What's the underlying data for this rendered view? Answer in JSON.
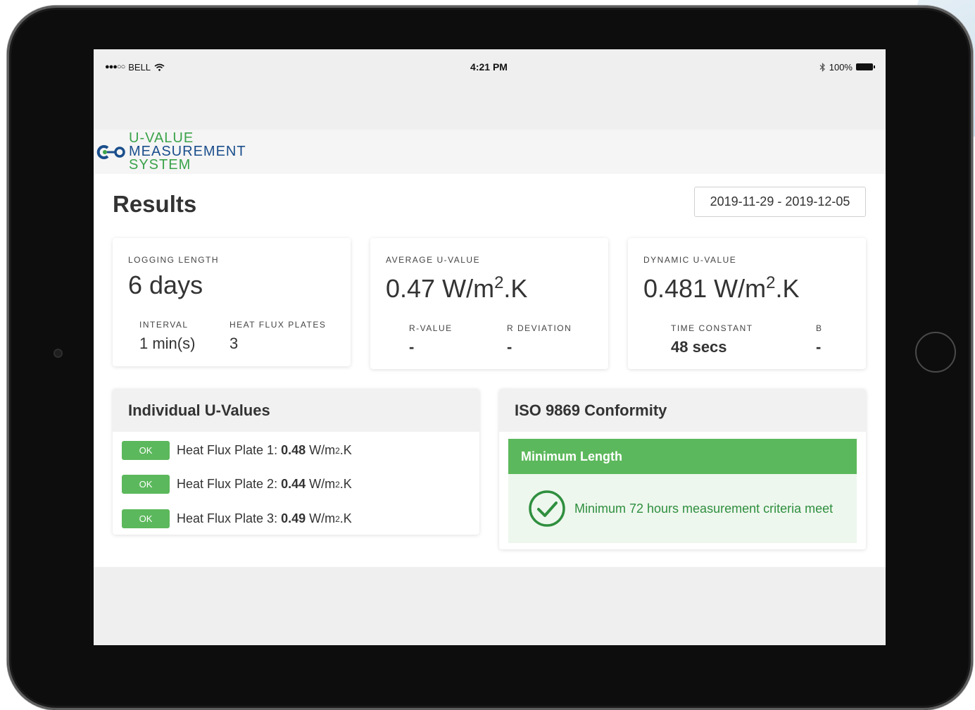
{
  "status_bar": {
    "signal": "●●●○○",
    "carrier": "BELL",
    "wifi_icon": "wifi-icon",
    "time": "4:21 PM",
    "bluetooth_icon": "bluetooth-icon",
    "battery": "100%"
  },
  "app": {
    "logo_line1": "U-VALUE",
    "logo_line2": "MEASUREMENT",
    "logo_line3": "SYSTEM"
  },
  "page": {
    "title": "Results",
    "date_range": "2019-11-29 - 2019-12-05"
  },
  "cards": {
    "logging": {
      "label": "LOGGING LENGTH",
      "value": "6 days",
      "interval_label": "INTERVAL",
      "interval_value": "1 min(s)",
      "plates_label": "HEAT FLUX PLATES",
      "plates_value": "3"
    },
    "average": {
      "label": "AVERAGE U-VALUE",
      "value": "0.47",
      "unit_pre": "W/m",
      "unit_sup": "2",
      "unit_post": ".K",
      "r_label": "R-VALUE",
      "r_value": "-",
      "rdev_label": "R DEVIATION",
      "rdev_value": "-"
    },
    "dynamic": {
      "label": "DYNAMIC U-VALUE",
      "value": "0.481",
      "unit_pre": "W/m",
      "unit_sup": "2",
      "unit_post": ".K",
      "tc_label": "TIME CONSTANT",
      "tc_value": "48 secs",
      "b_label": "B",
      "b_value": "-"
    }
  },
  "individual": {
    "title": "Individual U-Values",
    "rows": [
      {
        "badge": "OK",
        "label": "Heat Flux Plate 1:",
        "value": "0.48",
        "unit_pre": "W/m",
        "unit_sup": "2",
        "unit_post": ".K"
      },
      {
        "badge": "OK",
        "label": "Heat Flux Plate 2:",
        "value": "0.44",
        "unit_pre": "W/m",
        "unit_sup": "2",
        "unit_post": ".K"
      },
      {
        "badge": "OK",
        "label": "Heat Flux Plate 3:",
        "value": "0.49",
        "unit_pre": "W/m",
        "unit_sup": "2",
        "unit_post": ".K"
      }
    ]
  },
  "iso": {
    "title": "ISO 9869 Conformity",
    "criteria_title": "Minimum Length",
    "criteria_message": "Minimum 72 hours measurement criteria meet",
    "status_icon": "check-circle-icon"
  },
  "colors": {
    "ok_green": "#5cb85c",
    "logo_green": "#3aa34a",
    "logo_blue": "#1a4e8c"
  }
}
